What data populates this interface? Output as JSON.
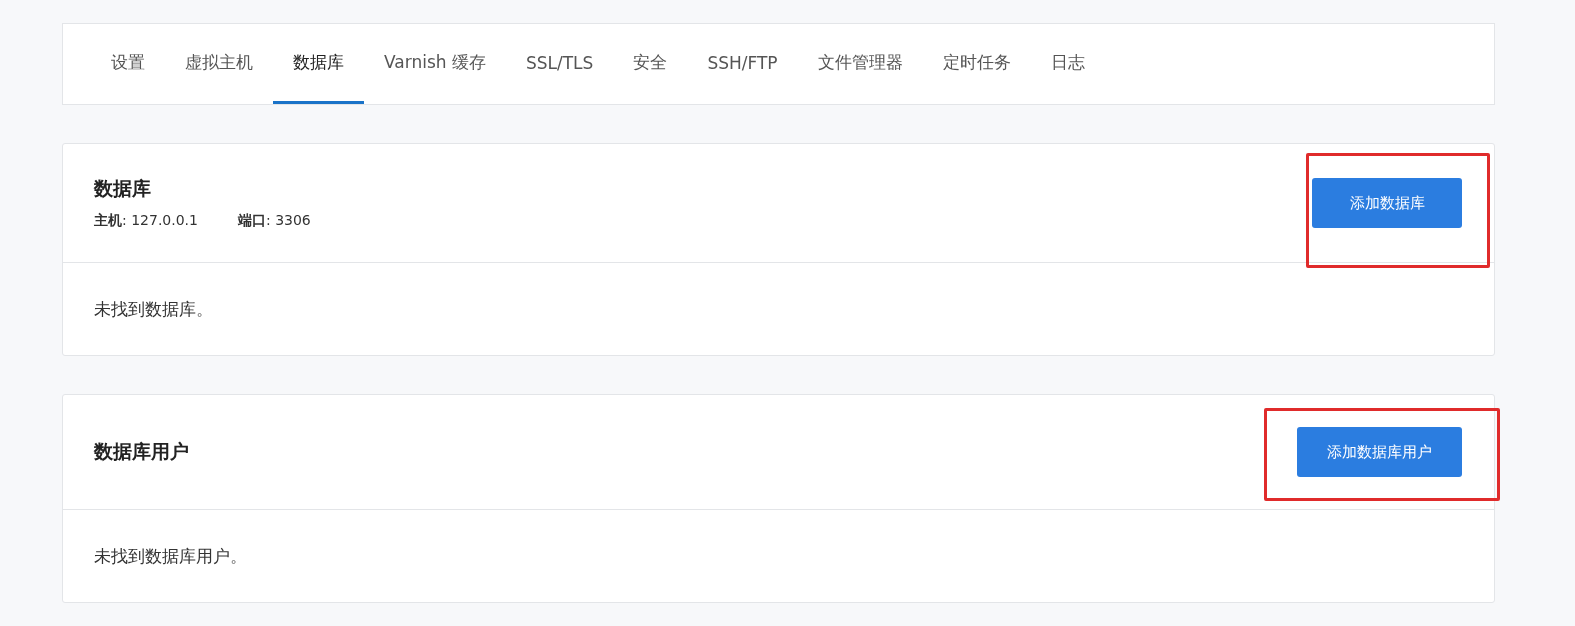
{
  "tabs": [
    {
      "label": "设置",
      "selected": false
    },
    {
      "label": "虚拟主机",
      "selected": false
    },
    {
      "label": "数据库",
      "selected": true
    },
    {
      "label": "Varnish 缓存",
      "selected": false
    },
    {
      "label": "SSL/TLS",
      "selected": false
    },
    {
      "label": "安全",
      "selected": false
    },
    {
      "label": "SSH/FTP",
      "selected": false
    },
    {
      "label": "文件管理器",
      "selected": false
    },
    {
      "label": "定时任务",
      "selected": false
    },
    {
      "label": "日志",
      "selected": false
    }
  ],
  "sections": [
    {
      "title": "数据库",
      "details": [
        {
          "label": "主机",
          "value": ": 127.0.0.1"
        },
        {
          "label": "端口",
          "value": ": 3306"
        }
      ],
      "button": {
        "label": "添加数据库",
        "highlighted": true
      },
      "empty_message": "未找到数据库。"
    },
    {
      "title": "数据库用户",
      "button": {
        "label": "添加数据库用户",
        "highlighted": true
      },
      "empty_message": "未找到数据库用户。"
    }
  ]
}
